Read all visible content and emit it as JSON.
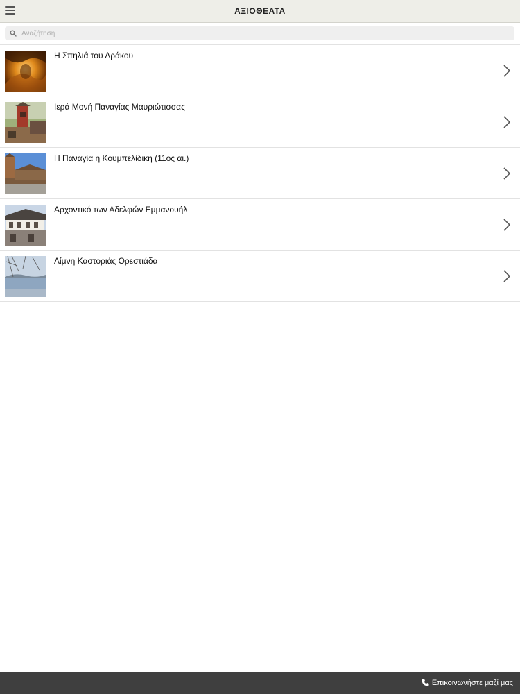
{
  "header": {
    "title": "ΑΞΙΟΘΕΑΤΑ",
    "menu_icon": "hamburger-menu-icon"
  },
  "search": {
    "placeholder": "Αναζήτηση",
    "value": "",
    "icon": "search-icon"
  },
  "list": {
    "items": [
      {
        "title": "Η Σπηλιά του Δράκου",
        "thumbnail": "cave-photo"
      },
      {
        "title": "Ιερά Μονή Παναγίας Μαυριώτισσας",
        "thumbnail": "monastery-photo"
      },
      {
        "title": "Η Παναγία η Κουμπελίδικη (11ος αι.)",
        "thumbnail": "church-photo"
      },
      {
        "title": "Αρχοντικό των Αδελφών Εμμανουήλ",
        "thumbnail": "mansion-photo"
      },
      {
        "title": "Λίμνη Καστοριάς Ορεστιάδα",
        "thumbnail": "lake-photo"
      }
    ],
    "chevron_icon": "chevron-right-icon"
  },
  "footer": {
    "contact_label": "Επικοινωνήστε μαζί μας",
    "contact_icon": "phone-icon"
  },
  "colors": {
    "header_bg": "#eeeee8",
    "footer_bg": "#3f3f3f",
    "search_bg": "#efefef"
  }
}
